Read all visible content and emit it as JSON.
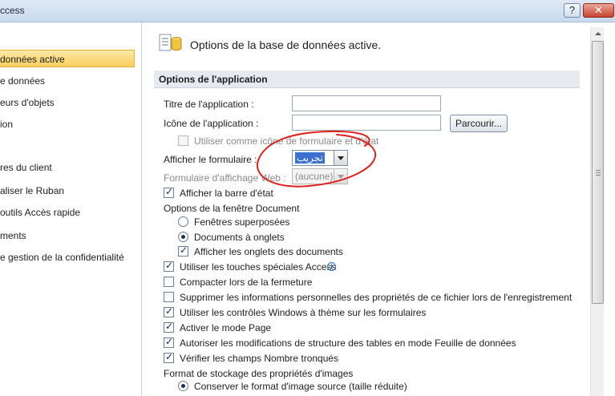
{
  "window": {
    "title": "ccess",
    "help_label": "?",
    "close_label": "✕"
  },
  "sidebar": {
    "items": [
      {
        "label": "données active",
        "active": true
      },
      {
        "label": "e données"
      },
      {
        "label": "eurs d'objets"
      },
      {
        "label": "ion"
      },
      {
        "label": "res du client"
      },
      {
        "label": "aliser le Ruban"
      },
      {
        "label": "outils Accès rapide"
      },
      {
        "label": "ments"
      },
      {
        "label": "e gestion de la confidentialité"
      }
    ]
  },
  "content": {
    "header": "Options de la base de données active.",
    "section": "Options de l'application",
    "app_title_label": "Titre de l'application :",
    "app_title_value": "",
    "app_icon_label": "Icône de l'application :",
    "app_icon_value": "",
    "browse_label": "Parcourir...",
    "use_icon_label": "Utiliser comme icône de formulaire et d'état",
    "display_form_label": "Afficher le formulaire :",
    "display_form_value": "تجريب",
    "web_form_label": "Formulaire d'affichage Web :",
    "web_form_value": "(aucune)",
    "status_bar_label": "Afficher la barre d'état",
    "doc_window_label": "Options de la fenêtre Document",
    "overlapping_label": "Fenêtres superposées",
    "tabbed_label": "Documents à onglets",
    "doc_tabs_label": "Afficher les onglets des documents",
    "access_keys_label": "Utiliser les touches spéciales Access",
    "compact_label": "Compacter lors de la fermeture",
    "remove_info_label": "Supprimer les informations personnelles des propriétés de ce fichier lors de l'enregistrement",
    "themed_label": "Utiliser les contrôles Windows à thème sur les formulaires",
    "layout_view_label": "Activer le mode Page",
    "design_changes_label": "Autoriser les modifications de structure des tables en mode Feuille de données",
    "truncated_label": "Vérifier les champs Nombre tronqués",
    "picture_format_label": "Format de stockage des propriétés d'images",
    "preserve_label": "Conserver le format d'image source (taille réduite)"
  },
  "colors": {
    "active_item": "#f9cf5d",
    "annotation": "#e0201c"
  }
}
